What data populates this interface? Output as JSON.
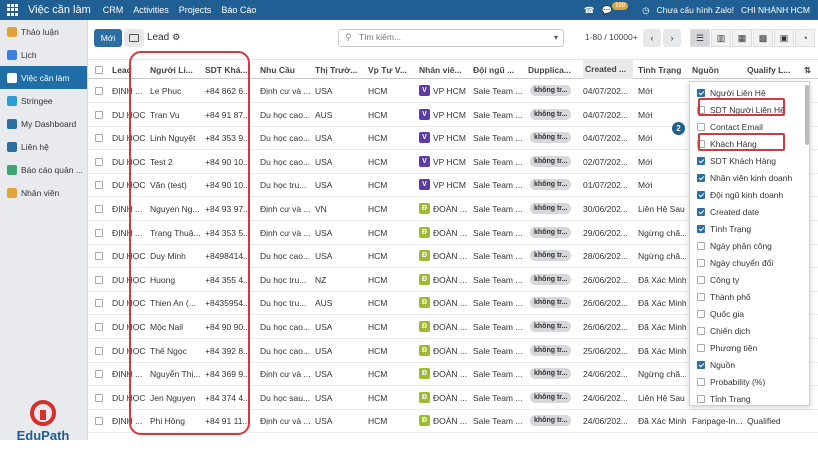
{
  "topbar": {
    "app_title": "Việc cần làm",
    "menu": [
      "CRM",
      "Activities",
      "Projects",
      "Báo Cáo"
    ],
    "chat_badge": "199",
    "zalo_text": "Chưa cấu hình Zalo!",
    "company": "CHI NHÁNH HCM"
  },
  "sidebar": {
    "items": [
      {
        "label": "Thảo luận",
        "icon": "discuss-icon",
        "color": "#e3a03a"
      },
      {
        "label": "Lịch",
        "icon": "calendar-icon",
        "color": "#3f7ee0"
      },
      {
        "label": "Việc cần làm",
        "icon": "todo-icon",
        "color": "#ffffff"
      },
      {
        "label": "Stringee",
        "icon": "stringee-icon",
        "color": "#2c9bd6"
      },
      {
        "label": "My Dashboard",
        "icon": "dashboard-icon",
        "color": "#2c6ea2"
      },
      {
        "label": "Liên hệ",
        "icon": "contacts-icon",
        "color": "#2c6ea2"
      },
      {
        "label": "Báo cáo quản ...",
        "icon": "report-icon",
        "color": "#3fa46f"
      },
      {
        "label": "Nhân viên",
        "icon": "employees-icon",
        "color": "#e0a23a"
      }
    ],
    "logo_text": "EduPath"
  },
  "control": {
    "new_label": "Mới",
    "breadcrumb": "Lead",
    "search_placeholder": "Tìm kiếm...",
    "pager": "1-80 / 10000+"
  },
  "table": {
    "headers": [
      "Lead",
      "Người Li...",
      "SDT Khá...",
      "Nhu Cầu",
      "Thị Trườ...",
      "Vp Tư V...",
      "Nhân viê...",
      "Đội ngũ ...",
      "Dupplica...",
      "Created ...",
      "Tình Trạng",
      "Nguồn",
      "Qualify L..."
    ],
    "rows": [
      {
        "lead": "ĐỊNH ...",
        "person": "Le Phuc",
        "phone": "+84 862 6...",
        "need": "Định cư và ...",
        "market": "USA",
        "vp": "HCM",
        "emp_av": "V",
        "emp_color": "#5b3aa8",
        "emp": "VP HCM",
        "team": "Sale Team ...",
        "dup": "không tr...",
        "created": "04/07/202...",
        "status": "Mới"
      },
      {
        "lead": "DU HỌC",
        "person": "Tran Vu",
        "phone": "+84 91 87...",
        "need": "Du học cao...",
        "market": "AUS",
        "vp": "HCM",
        "emp_av": "V",
        "emp_color": "#5b3aa8",
        "emp": "VP HCM",
        "team": "Sale Team ...",
        "dup": "không tr...",
        "created": "04/07/202...",
        "status": "Mới"
      },
      {
        "lead": "DU HỌC",
        "person": "Linh Nguyệt",
        "phone": "+84 353 9...",
        "need": "Du học cao...",
        "market": "USA",
        "vp": "HCM",
        "emp_av": "V",
        "emp_color": "#5b3aa8",
        "emp": "VP HCM",
        "team": "Sale Team ...",
        "dup": "không tr...",
        "created": "04/07/202...",
        "status": "Mới"
      },
      {
        "lead": "DU HỌC",
        "person": "Test 2",
        "phone": "+84 90 10...",
        "need": "Du học cao...",
        "market": "USA",
        "vp": "HCM",
        "emp_av": "V",
        "emp_color": "#5b3aa8",
        "emp": "VP HCM",
        "team": "Sale Team ...",
        "dup": "không tr...",
        "created": "02/07/202...",
        "status": "Mới"
      },
      {
        "lead": "DU HỌC",
        "person": "Văn (test)",
        "phone": "+84 90 10...",
        "need": "Du học tru...",
        "market": "USA",
        "vp": "HCM",
        "emp_av": "V",
        "emp_color": "#5b3aa8",
        "emp": "VP HCM",
        "team": "Sale Team ...",
        "dup": "không tr...",
        "created": "01/07/202...",
        "status": "Mới"
      },
      {
        "lead": "ĐỊNH ...",
        "person": "Nguyen Ng...",
        "phone": "+84 93 97...",
        "need": "Định cư và ...",
        "market": "VN",
        "vp": "HCM",
        "emp_av": "Đ",
        "emp_color": "#9cbb32",
        "emp": "ĐOÀN ...",
        "team": "Sale Team ...",
        "dup": "không tr...",
        "created": "30/06/202...",
        "status": "Liên Hệ Sau"
      },
      {
        "lead": "ĐỊNH ...",
        "person": "Trang Thuậ...",
        "phone": "+84 353 5...",
        "need": "Định cư và ...",
        "market": "USA",
        "vp": "HCM",
        "emp_av": "Đ",
        "emp_color": "#9cbb32",
        "emp": "ĐOÀN ...",
        "team": "Sale Team ...",
        "dup": "không tr...",
        "created": "29/06/202...",
        "status": "Ngừng chă..."
      },
      {
        "lead": "DU HỌC",
        "person": "Duy Minh",
        "phone": "+8498414...",
        "need": "Du học cao...",
        "market": "USA",
        "vp": "HCM",
        "emp_av": "Đ",
        "emp_color": "#9cbb32",
        "emp": "ĐOÀN ...",
        "team": "Sale Team ...",
        "dup": "không tr...",
        "created": "28/06/202...",
        "status": "Ngừng chă..."
      },
      {
        "lead": "DU HỌC",
        "person": "Huong",
        "phone": "+84 355 4...",
        "need": "Du học tru...",
        "market": "NZ",
        "vp": "HCM",
        "emp_av": "Đ",
        "emp_color": "#9cbb32",
        "emp": "ĐOÀN ...",
        "team": "Sale Team ...",
        "dup": "không tr...",
        "created": "26/06/202...",
        "status": "Đã Xác Minh"
      },
      {
        "lead": "DU HỌC",
        "person": "Thien An (...",
        "phone": "+8435954...",
        "need": "Du học tru...",
        "market": "AUS",
        "vp": "HCM",
        "emp_av": "Đ",
        "emp_color": "#9cbb32",
        "emp": "ĐOÀN ...",
        "team": "Sale Team ...",
        "dup": "không tr...",
        "created": "26/06/202...",
        "status": "Đã Xác Minh"
      },
      {
        "lead": "DU HỌC",
        "person": "Mộc Nail",
        "phone": "+84 90 90...",
        "need": "Du học cao...",
        "market": "USA",
        "vp": "HCM",
        "emp_av": "Đ",
        "emp_color": "#9cbb32",
        "emp": "ĐOÀN ...",
        "team": "Sale Team ...",
        "dup": "không tr...",
        "created": "26/06/202...",
        "status": "Đã Xác Minh"
      },
      {
        "lead": "DU HỌC",
        "person": "Thế Ngọc",
        "phone": "+84 392 8...",
        "need": "Du học cao...",
        "market": "USA",
        "vp": "HCM",
        "emp_av": "Đ",
        "emp_color": "#9cbb32",
        "emp": "ĐOÀN ...",
        "team": "Sale Team ...",
        "dup": "không tr...",
        "created": "25/06/202...",
        "status": "Đã Xác Minh"
      },
      {
        "lead": "ĐỊNH ...",
        "person": "Nguyễn Thị...",
        "phone": "+84 369 9...",
        "need": "Định cư và ...",
        "market": "USA",
        "vp": "HCM",
        "emp_av": "Đ",
        "emp_color": "#9cbb32",
        "emp": "ĐOÀN ...",
        "team": "Sale Team ...",
        "dup": "không tr...",
        "created": "24/06/202...",
        "status": "Ngừng chă..."
      },
      {
        "lead": "DU HỌC",
        "person": "Jen Nguyen",
        "phone": "+84 374 4...",
        "need": "Du học sau...",
        "market": "USA",
        "vp": "HCM",
        "emp_av": "Đ",
        "emp_color": "#9cbb32",
        "emp": "ĐOÀN ...",
        "team": "Sale Team ...",
        "dup": "không tr...",
        "created": "24/06/202...",
        "status": "Liên Hệ Sau"
      },
      {
        "lead": "ĐỊNH ...",
        "person": "Phi Hồng",
        "phone": "+84 91 11...",
        "need": "Định cư và ...",
        "market": "USA",
        "vp": "HCM",
        "emp_av": "Đ",
        "emp_color": "#9cbb32",
        "emp": "ĐOÀN ...",
        "team": "Sale Team ...",
        "dup": "không tr...",
        "created": "24/06/202...",
        "status": "Đã Xác Minh",
        "source": "Fanpage-In...",
        "qualify": "Qualified"
      }
    ]
  },
  "column_panel": {
    "callout": "2",
    "options": [
      {
        "label": "Người Liên Hệ",
        "checked": true
      },
      {
        "label": "SDT Người Liên Hệ",
        "checked": false
      },
      {
        "label": "Contact Email",
        "checked": false
      },
      {
        "label": "Khách Hàng",
        "checked": false
      },
      {
        "label": "SDT Khách Hàng",
        "checked": true
      },
      {
        "label": "Nhân viên kinh doanh",
        "checked": true
      },
      {
        "label": "Đội ngũ kinh doanh",
        "checked": true
      },
      {
        "label": "Created date",
        "checked": true
      },
      {
        "label": "Tình Trạng",
        "checked": true
      },
      {
        "label": "Ngày phân công",
        "checked": false
      },
      {
        "label": "Ngày chuyển đổi",
        "checked": false
      },
      {
        "label": "Công ty",
        "checked": false
      },
      {
        "label": "Thành phố",
        "checked": false
      },
      {
        "label": "Quốc gia",
        "checked": false
      },
      {
        "label": "Chiến dịch",
        "checked": false
      },
      {
        "label": "Phương tiện",
        "checked": false
      },
      {
        "label": "Nguồn",
        "checked": true
      },
      {
        "label": "Probability (%)",
        "checked": false
      },
      {
        "label": "Tỉnh Trạng",
        "checked": false
      }
    ]
  }
}
